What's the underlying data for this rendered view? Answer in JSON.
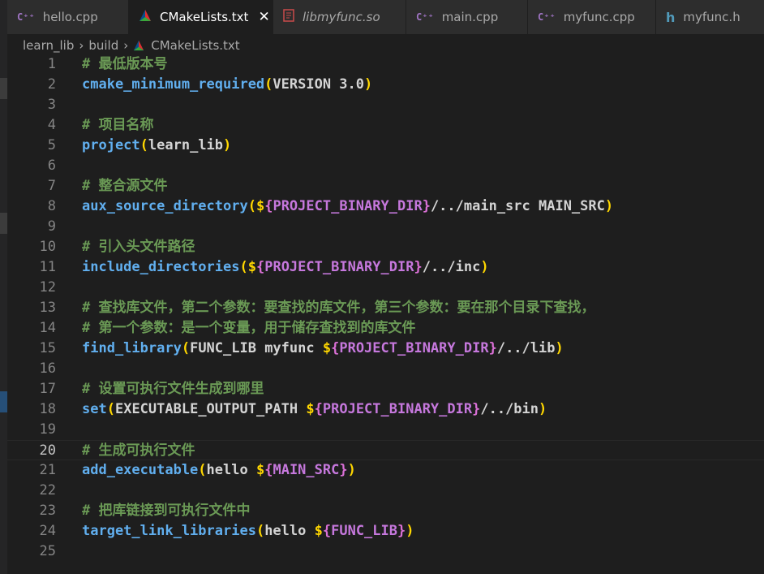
{
  "tabs": [
    {
      "label": "hello.cpp",
      "icon": "cpp-icon",
      "active": false
    },
    {
      "label": "CMakeLists.txt",
      "icon": "cmake-icon",
      "active": true
    },
    {
      "label": "libmyfunc.so",
      "icon": "binary-file-icon",
      "active": false
    },
    {
      "label": "main.cpp",
      "icon": "cpp-icon",
      "active": false
    },
    {
      "label": "myfunc.cpp",
      "icon": "cpp-icon",
      "active": false
    },
    {
      "label": "myfunc.h",
      "icon": "h-icon",
      "active": false
    }
  ],
  "breadcrumb": [
    "learn_lib",
    "build",
    "CMakeLists.txt"
  ],
  "editor": {
    "current_line": 20,
    "lines": [
      {
        "n": "1",
        "tokens": [
          [
            "comment",
            "# 最低版本号"
          ]
        ]
      },
      {
        "n": "2",
        "tokens": [
          [
            "fn",
            "cmake_minimum_required"
          ],
          [
            "paren",
            "("
          ],
          [
            "plain",
            "VERSION 3.0"
          ],
          [
            "paren",
            ")"
          ]
        ]
      },
      {
        "n": "3",
        "tokens": []
      },
      {
        "n": "4",
        "tokens": [
          [
            "comment",
            "# 项目名称"
          ]
        ]
      },
      {
        "n": "5",
        "tokens": [
          [
            "fn",
            "project"
          ],
          [
            "paren",
            "("
          ],
          [
            "plain",
            "learn_lib"
          ],
          [
            "paren",
            ")"
          ]
        ]
      },
      {
        "n": "6",
        "tokens": []
      },
      {
        "n": "7",
        "tokens": [
          [
            "comment",
            "# 整合源文件"
          ]
        ]
      },
      {
        "n": "8",
        "tokens": [
          [
            "fn",
            "aux_source_directory"
          ],
          [
            "paren",
            "("
          ],
          [
            "paren",
            "$"
          ],
          [
            "brace",
            "{"
          ],
          [
            "var",
            "PROJECT_BINARY_DIR"
          ],
          [
            "brace",
            "}"
          ],
          [
            "plain",
            "/../main_src MAIN_SRC"
          ],
          [
            "paren",
            ")"
          ]
        ]
      },
      {
        "n": "9",
        "tokens": []
      },
      {
        "n": "10",
        "tokens": [
          [
            "comment",
            "# 引入头文件路径"
          ]
        ]
      },
      {
        "n": "11",
        "tokens": [
          [
            "fn",
            "include_directories"
          ],
          [
            "paren",
            "("
          ],
          [
            "paren",
            "$"
          ],
          [
            "brace",
            "{"
          ],
          [
            "var",
            "PROJECT_BINARY_DIR"
          ],
          [
            "brace",
            "}"
          ],
          [
            "plain",
            "/../inc"
          ],
          [
            "paren",
            ")"
          ]
        ]
      },
      {
        "n": "12",
        "tokens": []
      },
      {
        "n": "13",
        "tokens": [
          [
            "comment",
            "# 查找库文件，第二个参数：要查找的库文件，第三个参数：要在那个目录下查找，"
          ]
        ]
      },
      {
        "n": "14",
        "tokens": [
          [
            "comment",
            "# 第一个参数：是一个变量，用于储存查找到的库文件"
          ]
        ]
      },
      {
        "n": "15",
        "tokens": [
          [
            "fn",
            "find_library"
          ],
          [
            "paren",
            "("
          ],
          [
            "plain",
            "FUNC_LIB myfunc "
          ],
          [
            "paren",
            "$"
          ],
          [
            "brace",
            "{"
          ],
          [
            "var",
            "PROJECT_BINARY_DIR"
          ],
          [
            "brace",
            "}"
          ],
          [
            "plain",
            "/../lib"
          ],
          [
            "paren",
            ")"
          ]
        ]
      },
      {
        "n": "16",
        "tokens": []
      },
      {
        "n": "17",
        "tokens": [
          [
            "comment",
            "# 设置可执行文件生成到哪里"
          ]
        ]
      },
      {
        "n": "18",
        "tokens": [
          [
            "fn",
            "set"
          ],
          [
            "paren",
            "("
          ],
          [
            "plain",
            "EXECUTABLE_OUTPUT_PATH "
          ],
          [
            "paren",
            "$"
          ],
          [
            "brace",
            "{"
          ],
          [
            "var",
            "PROJECT_BINARY_DIR"
          ],
          [
            "brace",
            "}"
          ],
          [
            "plain",
            "/../bin"
          ],
          [
            "paren",
            ")"
          ]
        ]
      },
      {
        "n": "19",
        "tokens": []
      },
      {
        "n": "20",
        "tokens": [
          [
            "comment",
            "# 生成可执行文件"
          ]
        ]
      },
      {
        "n": "21",
        "tokens": [
          [
            "fn",
            "add_executable"
          ],
          [
            "paren",
            "("
          ],
          [
            "plain",
            "hello "
          ],
          [
            "paren",
            "$"
          ],
          [
            "brace",
            "{"
          ],
          [
            "var",
            "MAIN_SRC"
          ],
          [
            "brace",
            "}"
          ],
          [
            "paren",
            ")"
          ]
        ]
      },
      {
        "n": "22",
        "tokens": []
      },
      {
        "n": "23",
        "tokens": [
          [
            "comment",
            "# 把库链接到可执行文件中"
          ]
        ]
      },
      {
        "n": "24",
        "tokens": [
          [
            "fn",
            "target_link_libraries"
          ],
          [
            "paren",
            "("
          ],
          [
            "plain",
            "hello "
          ],
          [
            "paren",
            "$"
          ],
          [
            "brace",
            "{"
          ],
          [
            "var",
            "FUNC_LIB"
          ],
          [
            "brace",
            "}"
          ],
          [
            "paren",
            ")"
          ]
        ]
      },
      {
        "n": "25",
        "tokens": []
      }
    ]
  },
  "colors": {
    "comment": "#6a9955",
    "function": "#61afef",
    "paren": "#ffd700",
    "brace": "#da70d6",
    "variable": "#c678dd",
    "text": "#d4d4d4"
  }
}
